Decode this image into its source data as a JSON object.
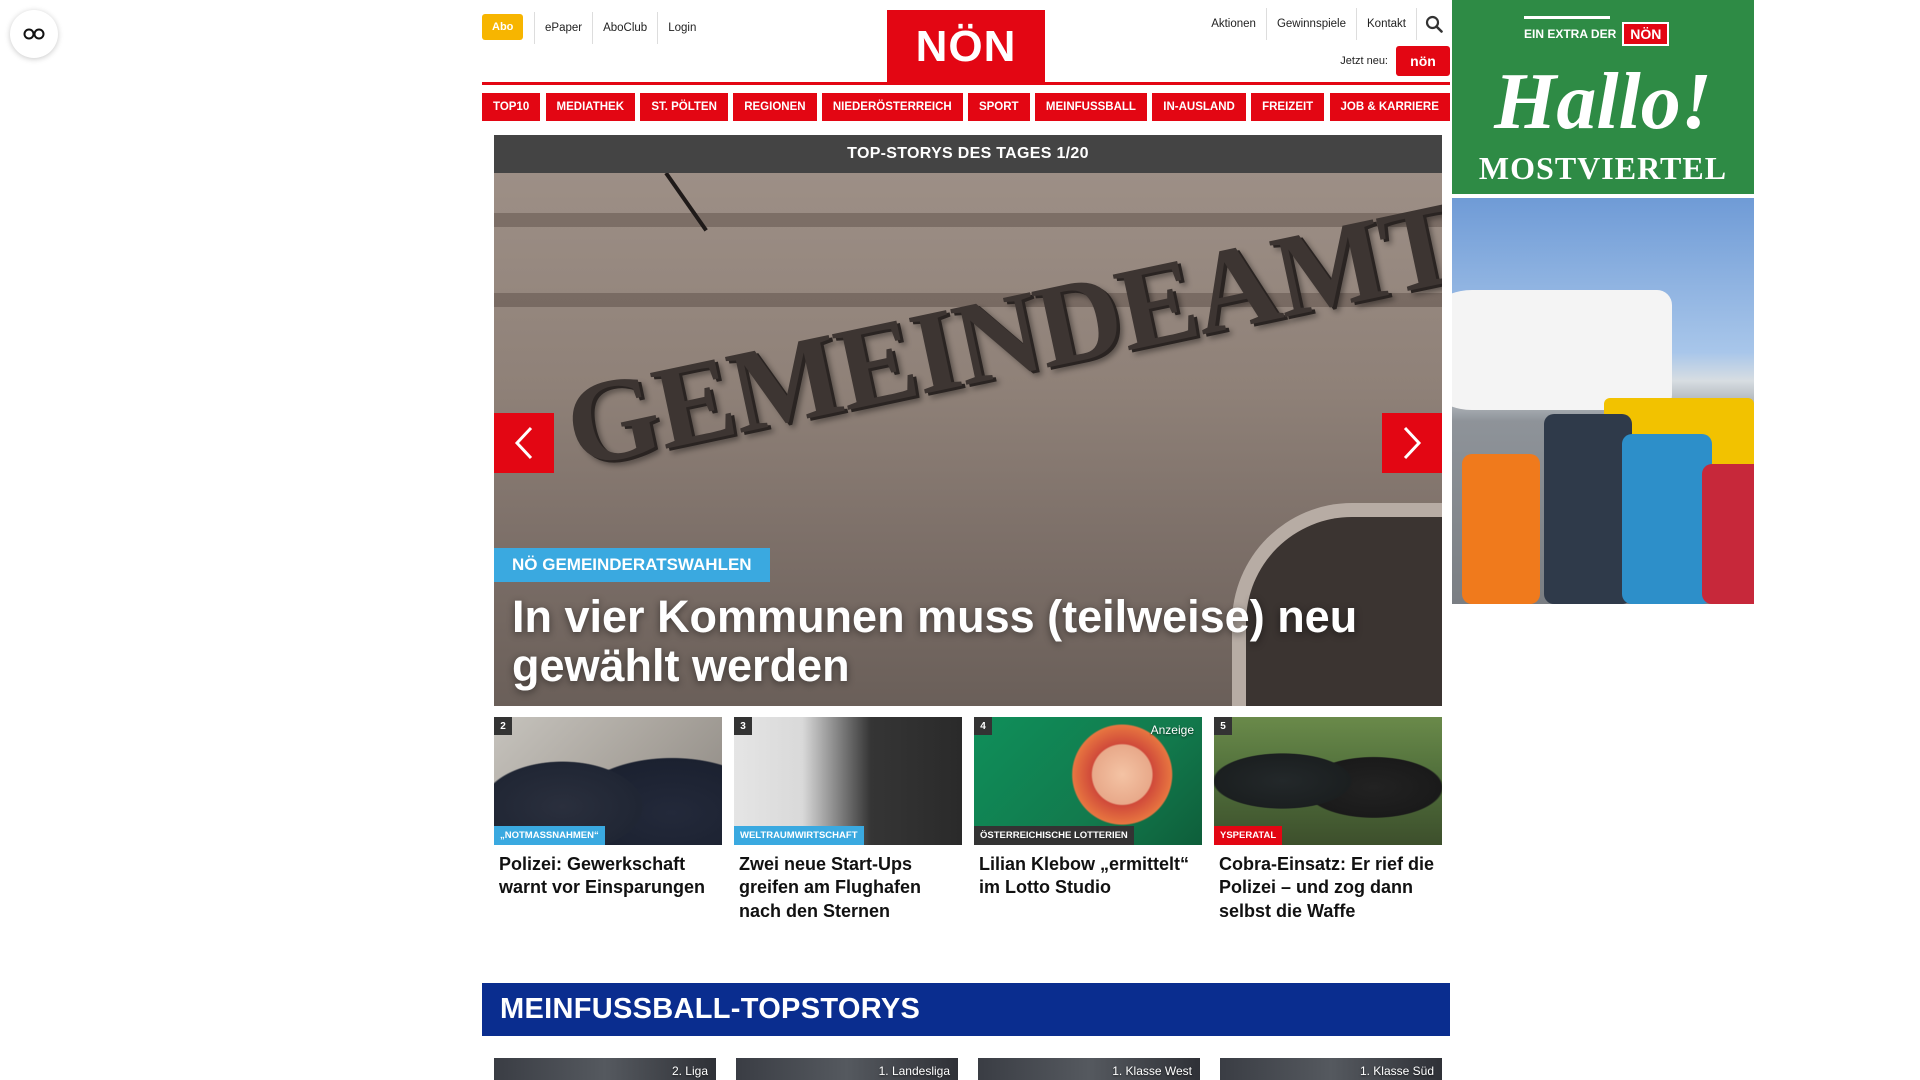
{
  "header": {
    "abo_label": "Abo",
    "links": [
      "ePaper",
      "AboClub",
      "Login"
    ],
    "logo_text": "NÖN",
    "right_links": [
      "Aktionen",
      "Gewinnspiele",
      "Kontakt"
    ],
    "jetzt_neu_label": "Jetzt neu:",
    "jetzt_logo_text": "nön"
  },
  "nav": {
    "items": [
      "TOP10",
      "MEDIATHEK",
      "ST. PÖLTEN",
      "REGIONEN",
      "NIEDERÖSTERREICH",
      "SPORT",
      "MEINFUSSBALL",
      "IN-AUSLAND",
      "FREIZEIT",
      "JOB & KARRIERE"
    ]
  },
  "slider": {
    "header": "TOP-STORYS DES TAGES 1/20",
    "image_text": "GEMEINDEAMT",
    "category": "NÖ GEMEINDERATSWAHLEN",
    "title": "In vier Kommunen muss (teilweise) neu gewählt werden"
  },
  "cards": [
    {
      "num": "2",
      "tag": "„Notmassnahmen“",
      "tag_color": "#3aa9e0",
      "title": "Polizei: Gewerkschaft warnt vor Einsparungen",
      "ad": ""
    },
    {
      "num": "3",
      "tag": "Weltraumwirtschaft",
      "tag_color": "#3aa9e0",
      "title": "Zwei neue Start-Ups greifen am Flughafen nach den Sternen",
      "ad": ""
    },
    {
      "num": "4",
      "tag": "Österreichische Lotterien",
      "tag_color": "#333333",
      "title": "Lilian Klebow „ermittelt“ im Lotto Studio",
      "ad": "Anzeige"
    },
    {
      "num": "5",
      "tag": "Ysperatal",
      "tag_color": "#e30613",
      "title": "Cobra-Einsatz: Er rief die Polizei – und zog dann selbst die Waffe",
      "ad": ""
    }
  ],
  "section": {
    "title": "MEINFUSSBALL-TOPSTORYS",
    "leagues": [
      "2. Liga",
      "1. Landesliga",
      "1. Klasse West",
      "1. Klasse Süd"
    ]
  },
  "ad": {
    "extra_label": "EIN EXTRA DER",
    "noen": "NÖN",
    "hallo": "Hallo!",
    "region": "MOSTVIERTEL"
  },
  "colors": {
    "brand_red": "#e30613",
    "abo_yellow": "#f7b500",
    "section_blue": "#0a2d8f",
    "category_blue": "#3aa9e0",
    "ad_green": "#2e8b45"
  }
}
